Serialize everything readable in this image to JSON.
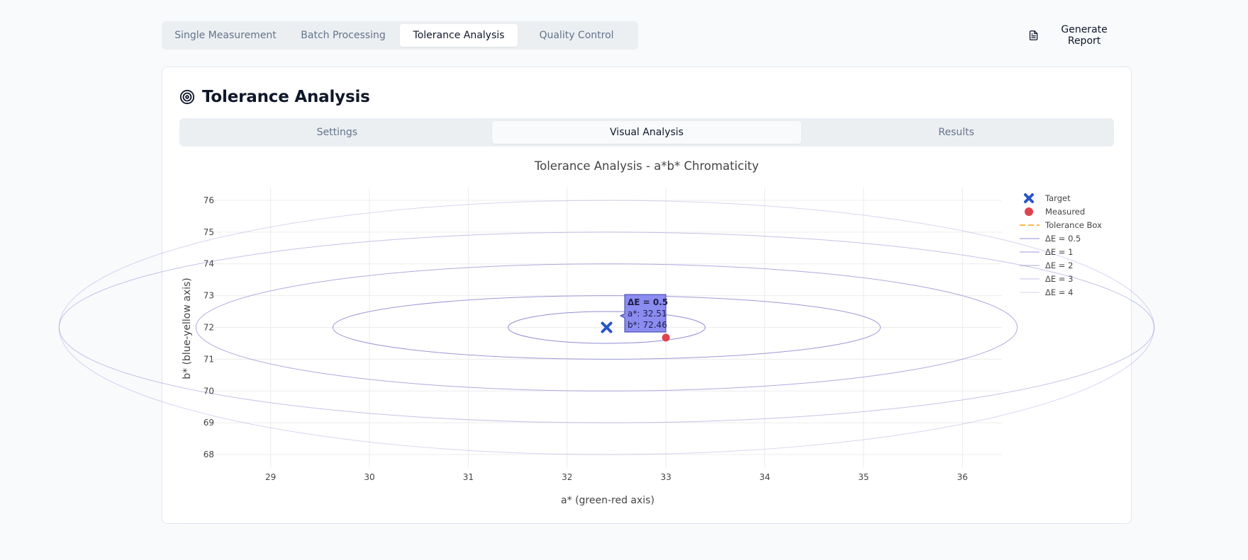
{
  "top_tabs": [
    {
      "label": "Single Measurement",
      "active": false
    },
    {
      "label": "Batch Processing",
      "active": false
    },
    {
      "label": "Tolerance Analysis",
      "active": true
    },
    {
      "label": "Quality Control",
      "active": false
    }
  ],
  "report_button": {
    "label": "Generate Report",
    "icon": "file-text-icon"
  },
  "card": {
    "title": "Tolerance Analysis",
    "icon": "target-icon"
  },
  "sub_tabs": [
    {
      "label": "Settings",
      "active": false
    },
    {
      "label": "Visual Analysis",
      "active": true
    },
    {
      "label": "Results",
      "active": false
    }
  ],
  "colors": {
    "target": "#2855c7",
    "measured": "#e0434f",
    "tolerance_box": "#f5b94a",
    "ellipse": "#8b87d1",
    "tooltip_bg": "#8b8cf0"
  },
  "chart_data": {
    "type": "scatter",
    "title": "Tolerance Analysis - a*b* Chromaticity",
    "xlabel": "a* (green-red axis)",
    "ylabel": "b* (blue-yellow axis)",
    "xlim": [
      28.4,
      36.4
    ],
    "ylim": [
      67.6,
      76.4
    ],
    "x_ticks": [
      "29",
      "30",
      "31",
      "32",
      "33",
      "34",
      "35",
      "36"
    ],
    "y_ticks": [
      "68",
      "69",
      "70",
      "71",
      "72",
      "73",
      "74",
      "75",
      "76"
    ],
    "grid": true,
    "legend_position": "top-right",
    "center": {
      "a": 32.4,
      "b": 72
    },
    "series": [
      {
        "name": "Target",
        "kind": "marker-x",
        "points": [
          {
            "a": 32.4,
            "b": 72
          }
        ]
      },
      {
        "name": "Measured",
        "kind": "marker-circle",
        "points": [
          {
            "a": 33.0,
            "b": 71.68
          }
        ]
      },
      {
        "name": "Tolerance Box",
        "kind": "dashed-box"
      },
      {
        "name": "ΔE = 0.5",
        "kind": "ellipse",
        "de": 0.5,
        "ra": 0.5,
        "rb": 1.0,
        "opacity": 0.95
      },
      {
        "name": "ΔE = 1",
        "kind": "ellipse",
        "de": 1,
        "ra": 1.0,
        "rb": 2.0,
        "opacity": 0.85
      },
      {
        "name": "ΔE = 2",
        "kind": "ellipse",
        "de": 2,
        "ra": 2.0,
        "rb": 3.0,
        "opacity": 0.7
      },
      {
        "name": "ΔE = 3",
        "kind": "ellipse",
        "de": 3,
        "ra": 3.0,
        "rb": 4.0,
        "opacity": 0.5
      },
      {
        "name": "ΔE = 4",
        "kind": "ellipse",
        "de": 4,
        "ra": 4.0,
        "rb": 4.0,
        "opacity": 0.35
      }
    ],
    "tooltip": {
      "title": "ΔE = 0.5",
      "lines": [
        "a*: 32.51",
        "b*: 72.46"
      ]
    }
  }
}
